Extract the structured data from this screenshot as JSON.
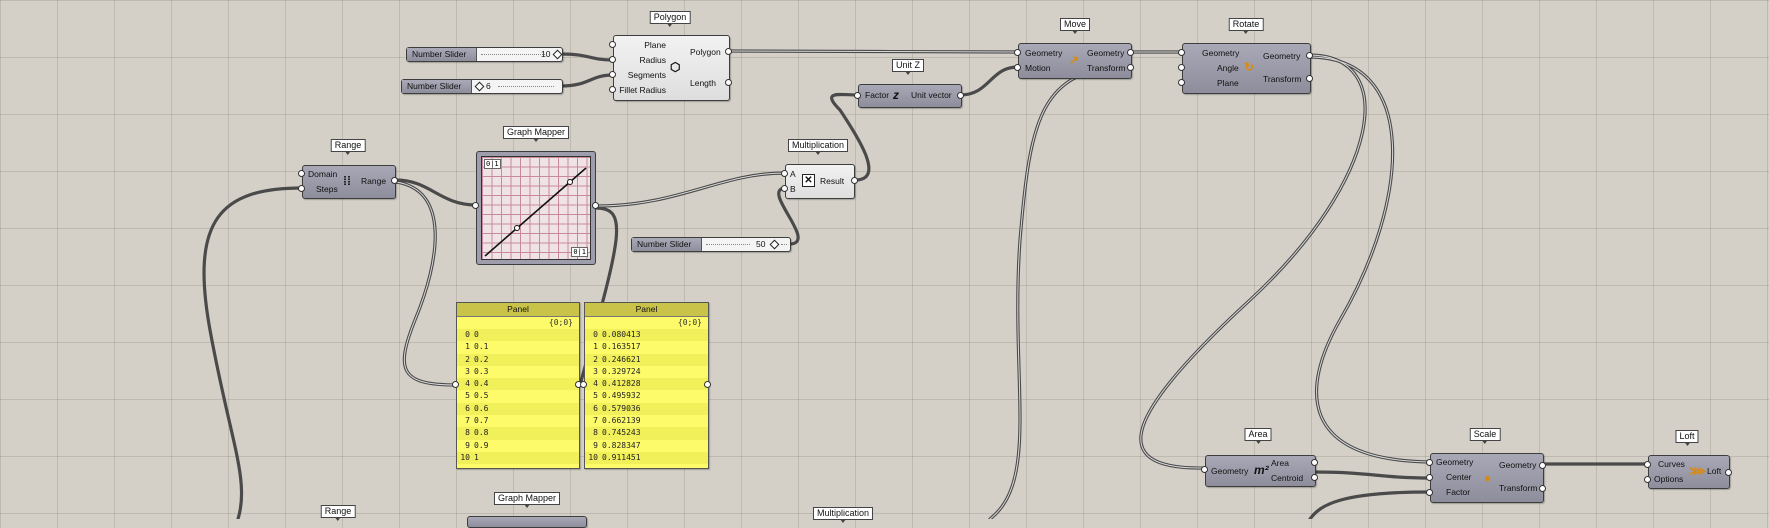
{
  "components": {
    "polygon": {
      "tag": "Polygon",
      "inputs": [
        "Plane",
        "Radius",
        "Segments",
        "Fillet Radius"
      ],
      "outputs": [
        "Polygon",
        "Length"
      ]
    },
    "slider_radius": {
      "label": "Number Slider",
      "value": "10"
    },
    "slider_segments": {
      "label": "Number Slider",
      "value": "6"
    },
    "slider_mult": {
      "label": "Number Slider",
      "value": "50"
    },
    "move": {
      "tag": "Move",
      "inputs": [
        "Geometry",
        "Motion"
      ],
      "outputs": [
        "Geometry",
        "Transform"
      ]
    },
    "rotate": {
      "tag": "Rotate",
      "inputs": [
        "Geometry",
        "Angle",
        "Plane"
      ],
      "outputs": [
        "Geometry",
        "Transform"
      ]
    },
    "unitz": {
      "tag": "Unit Z",
      "inputs": [
        "Factor"
      ],
      "outputs": [
        "Unit vector"
      ]
    },
    "range": {
      "tag": "Range",
      "inputs": [
        "Domain",
        "Steps"
      ],
      "outputs": [
        "Range"
      ]
    },
    "graph_mapper": {
      "tag": "Graph Mapper",
      "corner_tl": "0|1",
      "corner_br": "0|1"
    },
    "multiplication": {
      "tag": "Multiplication",
      "inputs": [
        "A",
        "B"
      ],
      "outputs": [
        "Result"
      ]
    },
    "panel1": {
      "title": "Panel",
      "path": "{0;0}",
      "rows": [
        "0",
        "0.1",
        "0.2",
        "0.3",
        "0.4",
        "0.5",
        "0.6",
        "0.7",
        "0.8",
        "0.9",
        "1"
      ]
    },
    "panel2": {
      "title": "Panel",
      "path": "{0;0}",
      "rows": [
        "0.080413",
        "0.163517",
        "0.246621",
        "0.329724",
        "0.412828",
        "0.495932",
        "0.579036",
        "0.662139",
        "0.745243",
        "0.828347",
        "0.911451"
      ]
    },
    "area": {
      "tag": "Area",
      "inputs": [
        "Geometry"
      ],
      "outputs": [
        "Area",
        "Centroid"
      ]
    },
    "scale": {
      "tag": "Scale",
      "inputs": [
        "Geometry",
        "Center",
        "Factor"
      ],
      "outputs": [
        "Geometry",
        "Transform"
      ]
    },
    "loft": {
      "tag": "Loft",
      "inputs": [
        "Curves",
        "Options"
      ],
      "outputs": [
        "Loft"
      ]
    },
    "range2": {
      "tag": "Range"
    },
    "graph_mapper2": {
      "tag": "Graph Mapper"
    },
    "multiplication2": {
      "tag": "Multiplication"
    }
  },
  "icons": {
    "polygon": "hexagon-icon",
    "move": "move-arrow-icon",
    "rotate": "rotate-icon",
    "unitz": "unit-z-icon",
    "range": "range-icon",
    "multiplication": "multiply-icon",
    "area": "area-icon",
    "scale": "scale-icon",
    "loft": "loft-icon"
  },
  "colors": {
    "canvas": "#d4d0c8",
    "component": "#9d9cab",
    "panel": "#fdfb6a",
    "panel_header": "#c9c34a",
    "wire": "#555555"
  }
}
